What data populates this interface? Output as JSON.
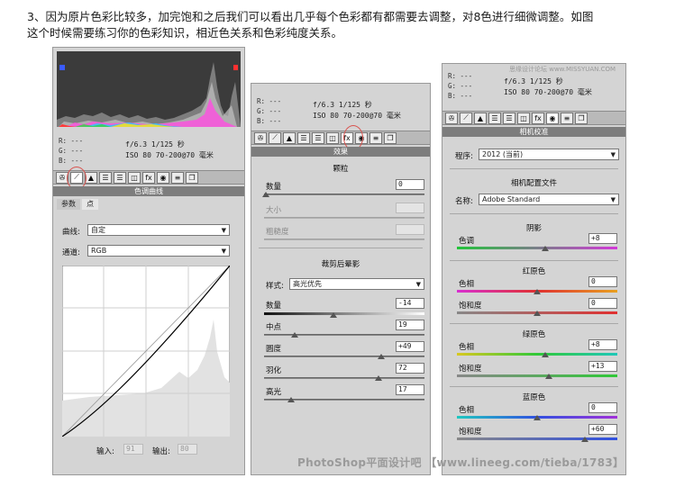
{
  "intro_lines": [
    "3、因为原片色彩比较多，加完饱和之后我们可以看出几乎每个色彩都有都需要去调整，对8色进行细微调整。如图",
    "这个时候需要练习你的色彩知识，相近色关系和色彩纯度关系。"
  ],
  "rgb_readout": {
    "r": "R:  ---",
    "g": "G:  ---",
    "b": "B:  ---"
  },
  "camera_info": {
    "line1": "f/6.3   1/125 秒",
    "line2": "ISO 80   70-200@70 毫米"
  },
  "panel1": {
    "title": "色调曲线",
    "tabs": [
      "参数",
      "点"
    ],
    "curve_label": "曲线:",
    "curve_value": "自定",
    "channel_label": "通道:",
    "channel_value": "RGB",
    "input_label": "输入:",
    "input_value": "91",
    "output_label": "输出:",
    "output_value": "80"
  },
  "panel2": {
    "title": "效果",
    "grain_title": "颗粒",
    "amount_label": "数量",
    "amount_value": "0",
    "size_label": "大小",
    "roughness_label": "粗糙度",
    "vignette_title": "裁剪后晕影",
    "style_label": "样式:",
    "style_value": "高光优先",
    "v_amount_label": "数量",
    "v_amount_value": "-14",
    "midpoint_label": "中点",
    "midpoint_value": "19",
    "roundness_label": "圆度",
    "roundness_value": "+49",
    "feather_label": "羽化",
    "feather_value": "72",
    "highlights_label": "高光",
    "highlights_value": "17"
  },
  "panel3": {
    "site": "思缘设计论坛 www.MISSYUAN.COM",
    "title": "相机校准",
    "process_label": "程序:",
    "process_value": "2012 (当前)",
    "profile_title": "相机配置文件",
    "name_label": "名称:",
    "name_value": "Adobe Standard",
    "shadows_title": "阴影",
    "tint_label": "色调",
    "tint_value": "+8",
    "red_title": "红原色",
    "red_hue_label": "色相",
    "red_hue_value": "0",
    "red_sat_label": "饱和度",
    "red_sat_value": "0",
    "green_title": "绿原色",
    "green_hue_label": "色相",
    "green_hue_value": "+8",
    "green_sat_label": "饱和度",
    "green_sat_value": "+13",
    "blue_title": "蓝原色",
    "blue_hue_label": "色相",
    "blue_hue_value": "0",
    "blue_sat_label": "饱和度",
    "blue_sat_value": "+60"
  },
  "watermark": "PhotoShop平面设计吧 【www.lineeg.com/tieba/1783】",
  "colors": {
    "panel": "#d4d4d4",
    "title_bar": "#7d7d7d",
    "highlight": "#d9534f"
  }
}
